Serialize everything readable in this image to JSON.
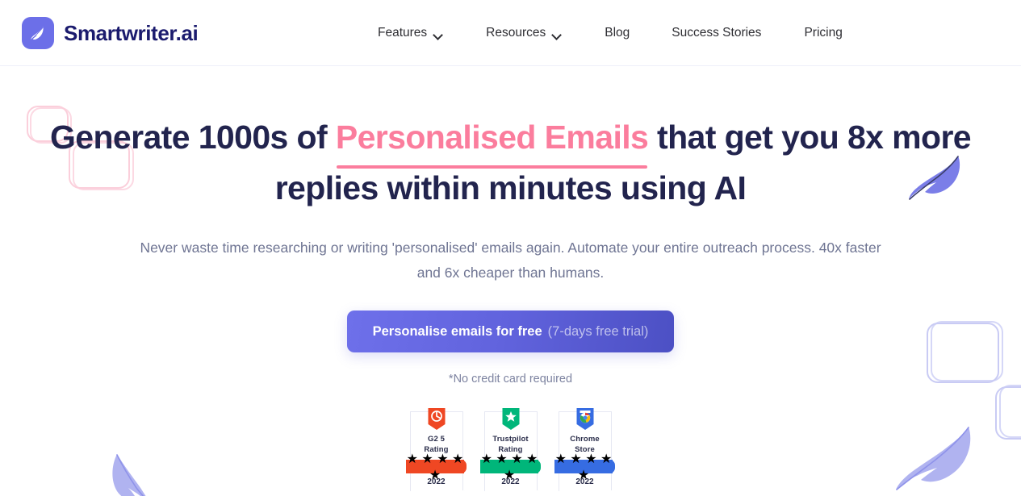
{
  "brand": {
    "name": "Smartwriter.ai",
    "logo_icon": "feather-icon",
    "logo_bg": "#6c6fe8",
    "text_color": "#1b1b6e"
  },
  "nav": {
    "items": [
      {
        "label": "Features",
        "has_dropdown": true,
        "icon": "chevron-down-icon"
      },
      {
        "label": "Resources",
        "has_dropdown": true,
        "icon": "chevron-down-icon"
      },
      {
        "label": "Blog",
        "has_dropdown": false
      },
      {
        "label": "Success Stories",
        "has_dropdown": false
      },
      {
        "label": "Pricing",
        "has_dropdown": false
      }
    ]
  },
  "hero": {
    "headline_part1": "Generate 1000s of ",
    "headline_accent": "Personalised Emails",
    "headline_part2": " that get you 8x more replies within minutes using AI",
    "accent_color": "#fb7d9d",
    "headline_color": "#22244e",
    "subheading": "Never waste time researching or writing 'personalised' emails again. Automate your entire outreach process. 40x faster and 6x cheaper than humans.",
    "cta_label": "Personalise emails for free",
    "cta_sublabel": "(7-days free trial)",
    "cta_gradient_from": "#6e70ea",
    "cta_gradient_to": "#4c50c4",
    "no_credit_card": "*No credit card required"
  },
  "badges": [
    {
      "logo_icon": "g2-icon",
      "title_line1": "G2 5",
      "title_line2": "Rating",
      "stars": "★ ★ ★ ★ ★",
      "year": "2022",
      "color": "#ef4723"
    },
    {
      "logo_icon": "trustpilot-icon",
      "title_line1": "Trustpilot",
      "title_line2": "Rating",
      "stars": "★ ★ ★ ★ ★",
      "year": "2022",
      "color": "#00b67a"
    },
    {
      "logo_icon": "chrome-store-icon",
      "title_line1": "Chrome",
      "title_line2": "Store",
      "stars": "★ ★ ★ ★ ★",
      "year": "2022",
      "color": "#366ce2"
    }
  ],
  "decor": {
    "pink_square_color": "#fbcfdb",
    "purple_square_color": "#c9cbf4",
    "feather_color": "#7b7ee8",
    "feather_light_color": "#b0b3f0"
  }
}
